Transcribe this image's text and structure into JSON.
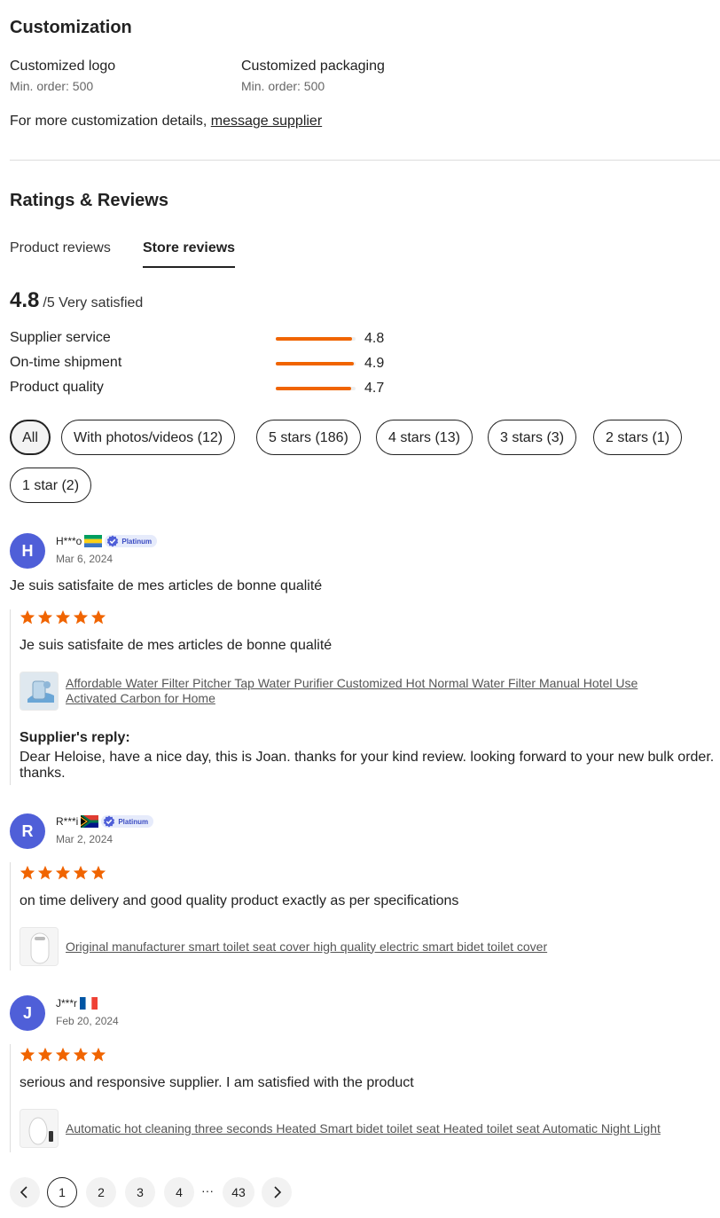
{
  "customization": {
    "title": "Customization",
    "items": [
      {
        "name": "Customized logo",
        "min": "Min. order: 500"
      },
      {
        "name": "Customized packaging",
        "min": "Min. order: 500"
      }
    ],
    "note_prefix": "For more customization details, ",
    "note_link": "message supplier"
  },
  "reviews_section": {
    "title": "Ratings & Reviews",
    "tabs": [
      {
        "label": "Product reviews",
        "active": false
      },
      {
        "label": "Store reviews",
        "active": true
      }
    ],
    "score": "4.8",
    "score_suffix": "/5 Very satisfied",
    "metrics": [
      {
        "label": "Supplier service",
        "value": "4.8",
        "fraction": 0.96
      },
      {
        "label": "On-time shipment",
        "value": "4.9",
        "fraction": 0.98
      },
      {
        "label": "Product quality",
        "value": "4.7",
        "fraction": 0.94
      }
    ],
    "filters": [
      {
        "label": "All",
        "selected": true
      },
      {
        "label": "With photos/videos (12)",
        "selected": false
      },
      {
        "label": "5 stars (186)",
        "selected": false
      },
      {
        "label": "4 stars (13)",
        "selected": false
      },
      {
        "label": "3 stars (3)",
        "selected": false
      },
      {
        "label": "2 stars (1)",
        "selected": false
      },
      {
        "label": "1 star (2)",
        "selected": false
      }
    ]
  },
  "reviews": [
    {
      "initial": "H",
      "user": "H***o",
      "flag": "gabon-flag",
      "badge": "Platinum",
      "date": "Mar 6, 2024",
      "headline": "Je suis satisfaite de mes articles de bonne qualité",
      "stars": 5,
      "text": "Je suis satisfaite de mes articles de bonne qualité",
      "product": "Affordable Water Filter Pitcher Tap Water Purifier Customized Hot Normal Water Filter Manual Hotel Use Activated Carbon for Home",
      "reply_label": "Supplier's reply:",
      "reply": "Dear Heloise, have a nice day, this is Joan. thanks for your kind review. looking forward to your new bulk order. thanks."
    },
    {
      "initial": "R",
      "user": "R***i",
      "flag": "south-africa-flag",
      "badge": "Platinum",
      "date": "Mar 2, 2024",
      "stars": 5,
      "text": "on time delivery and good quality product exactly as per specifications",
      "product": "Original manufacturer smart toilet seat cover high quality electric smart bidet toilet cover"
    },
    {
      "initial": "J",
      "user": "J***r",
      "flag": "france-flag",
      "date": "Feb 20, 2024",
      "stars": 5,
      "text": "serious and responsive supplier. I am satisfied with the product",
      "product": "Automatic hot cleaning three seconds Heated Smart bidet toilet seat Heated toilet seat Automatic Night Light"
    }
  ],
  "pagination": {
    "prev_icon": "chevron-left-icon",
    "pages": [
      "1",
      "2",
      "3",
      "4"
    ],
    "current": "1",
    "ellipsis": "···",
    "last": "43",
    "next_icon": "chevron-right-icon"
  },
  "colors": {
    "accent": "#f06400",
    "avatar": "#4f5fd8",
    "badge_bg": "#e6ebfb",
    "badge_text": "#3a4bc2"
  }
}
